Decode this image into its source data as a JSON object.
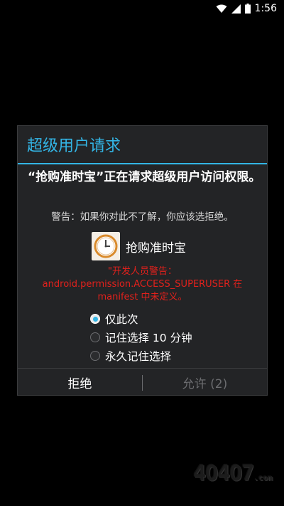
{
  "status_bar": {
    "time": "1:56",
    "icons": [
      "wifi-icon",
      "signal-icon",
      "battery-icon"
    ]
  },
  "dialog": {
    "title": "超级用户请求",
    "message": "“抢购准时宝”正在请求超级用户访问权限。",
    "warning_hint": "警告：如果你对此不了解，你应该选拒绝。",
    "app_name": "抢购准时宝",
    "app_icon": "clock-icon",
    "dev_warning_lines": [
      "\"开发人员警告：",
      "android.permission.ACCESS_SUPERUSER 在",
      "manifest 中未定义。"
    ],
    "options": [
      {
        "label": "仅此次",
        "checked": true
      },
      {
        "label": "记住选择 10 分钟",
        "checked": false
      },
      {
        "label": "永久记住选择",
        "checked": false
      }
    ],
    "deny_label": "拒绝",
    "allow_label": "允许 (2)"
  },
  "watermark": {
    "main": "4O4O7",
    "suffix": ".com"
  },
  "colors": {
    "accent": "#33b5e5",
    "warning": "#e2211c",
    "dialog_bg": "#232426",
    "disabled": "#6c6d70"
  }
}
